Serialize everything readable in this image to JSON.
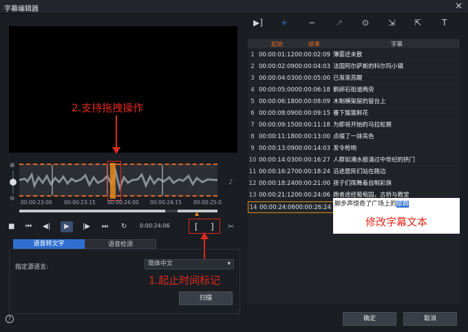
{
  "window": {
    "title": "字幕编辑器",
    "close": "✕"
  },
  "annotations": {
    "drag": "2.支持拖拽操作",
    "marks": "1.起止时间标记",
    "edit": "修改字幕文本"
  },
  "timeline": {
    "ticks": [
      "00:00:23:00",
      "00:00:23:15",
      "00:00:24:00",
      "00:00:24:15",
      "00:00:25:0"
    ],
    "zoom_in": "⊕",
    "zoom_out": "⊖"
  },
  "transport": {
    "stop": "■",
    "prev": "⏮",
    "step_back": "◀|",
    "play": "▶",
    "step_fwd": "|▶",
    "next": "⏭",
    "loop": "↻",
    "timecode": "0:00:24:06",
    "mark_in": "[",
    "mark_out": "]",
    "split": "✂"
  },
  "tabs": {
    "speech_to_text": "语音转文字",
    "speech_detect": "语音检测"
  },
  "panel": {
    "lang_label": "指定源语言:",
    "lang_value": "简体中文",
    "lang_arrow": "▾",
    "scan": "扫描"
  },
  "toolbar": {
    "icons": [
      "▶]",
      "+",
      "−",
      "↗",
      "⊙",
      "⇲",
      "⇱",
      "T"
    ]
  },
  "table": {
    "headers": {
      "start": "起始",
      "end": "结束",
      "text": "字幕"
    },
    "rows": [
      {
        "n": "1",
        "start": "00:00:01:12",
        "end": "00:00:02:09",
        "text": "薄雾还未散"
      },
      {
        "n": "2",
        "start": "00:00:02:09",
        "end": "00:00:04:03",
        "text": "法国阿尔萨斯的科尔玛小镇"
      },
      {
        "n": "3",
        "start": "00:00:04:03",
        "end": "00:00:05:00",
        "text": "已渐渐苏醒"
      },
      {
        "n": "4",
        "start": "00:00:05:00",
        "end": "00:00:06:18",
        "text": "鹅卵石街道两旁"
      },
      {
        "n": "5",
        "start": "00:00:06:18",
        "end": "00:00:08:09",
        "text": "木制横架屋的窗台上"
      },
      {
        "n": "6",
        "start": "00:00:08:09",
        "end": "00:00:09:15",
        "text": "垂下簇簇鲜花"
      },
      {
        "n": "7",
        "start": "00:00:09:15",
        "end": "00:00:11:18",
        "text": "为即将开始的马拉松赛"
      },
      {
        "n": "8",
        "start": "00:00:11:18",
        "end": "00:00:13:00",
        "text": "点缀了一抹亮色"
      },
      {
        "n": "9",
        "start": "00:00:13:09",
        "end": "00:00:14:03",
        "text": "发令枪响"
      },
      {
        "n": "10",
        "start": "00:00:14:03",
        "end": "00:00:16:27",
        "text": "人群如潮水般涌过中世纪的拱门"
      },
      {
        "n": "11",
        "start": "00:00:16:27",
        "end": "00:00:18:24",
        "text": "沿途居民们站在路边"
      },
      {
        "n": "12",
        "start": "00:00:18:24",
        "end": "00:00:21:00",
        "text": "孩子们挥舞着自制彩旗"
      },
      {
        "n": "13",
        "start": "00:00:21:12",
        "end": "00:00:24:06",
        "text": "跑者途经葡萄园，古桥与教堂"
      },
      {
        "n": "14",
        "start": "00:00:24:06",
        "end": "00:00:26:24",
        "text": ""
      }
    ],
    "edit_text": "脚步声惊奇了广场上的",
    "edit_highlight": "歇群"
  },
  "footer": {
    "help": "?",
    "ok": "确定",
    "cancel": "取消"
  },
  "colors": {
    "accent": "#2f6fd0",
    "annotation": "#e02a1e",
    "marker": "#e88a1a"
  }
}
